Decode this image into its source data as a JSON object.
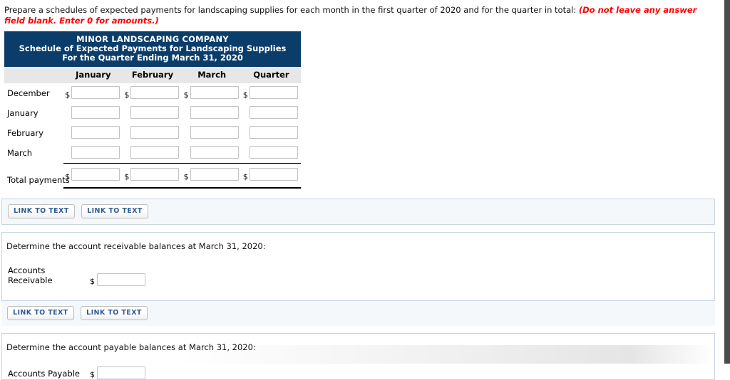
{
  "prompt": {
    "text": "Prepare a schedules of expected payments for landscaping supplies for each month in the first quarter of 2020 and for the quarter in total:",
    "hint": "(Do not leave any answer field blank. Enter 0 for amounts.)"
  },
  "schedule": {
    "header": {
      "company": "MINOR LANDSCAPING COMPANY",
      "title": "Schedule of Expected Payments for Landscaping Supplies",
      "period": "For the Quarter Ending March 31, 2020"
    },
    "columns": [
      "",
      "January",
      "February",
      "March",
      "Quarter"
    ],
    "rows": [
      {
        "label": "December",
        "show_dollar": true,
        "values": [
          "",
          "",
          "",
          ""
        ]
      },
      {
        "label": "January",
        "show_dollar": false,
        "values": [
          "",
          "",
          "",
          ""
        ]
      },
      {
        "label": "February",
        "show_dollar": false,
        "values": [
          "",
          "",
          "",
          ""
        ]
      },
      {
        "label": "March",
        "show_dollar": false,
        "values": [
          "",
          "",
          "",
          ""
        ]
      },
      {
        "label": "Total payments",
        "show_dollar": true,
        "values": [
          "",
          "",
          "",
          ""
        ]
      }
    ]
  },
  "link_buttons": {
    "label": "LINK TO TEXT",
    "count": 2
  },
  "section_receivable": {
    "question": "Determine the account receivable balances at March 31, 2020:",
    "row_label": "Accounts Receivable",
    "dollar": "$",
    "value": ""
  },
  "section_payable": {
    "question": "Determine the account payable balances at March 31, 2020:",
    "row_label": "Accounts Payable",
    "dollar": "$",
    "value": ""
  },
  "symbols": {
    "dollar": "$"
  },
  "colors": {
    "header_navy": "#0b3d6b",
    "colhead_gray": "#e7e7e7",
    "hint_red": "#ff0000",
    "button_text": "#2e5b94",
    "panel_border": "#c9d4e0",
    "linkbar_bg": "#f4f8fb"
  }
}
